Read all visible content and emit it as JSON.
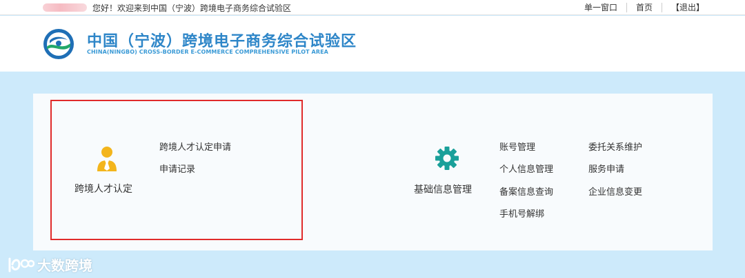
{
  "topbar": {
    "greeting": "您好！欢迎来到中国（宁波）跨境电子商务综合试验区",
    "links": [
      "单一窗口",
      "首页",
      "【退出】"
    ]
  },
  "header": {
    "title_cn": "中国（宁波）跨境电子商务综合试验区",
    "title_en": "CHINA(NINGBO) CROSS-BORDER E-COMMERCE  COMPREHENSIVE PILOT AREA"
  },
  "modules": {
    "talent": {
      "label": "跨境人才认定",
      "icon": "user-tie-icon",
      "links": [
        "跨境人才认定申请",
        "申请记录"
      ]
    },
    "info": {
      "label": "基础信息管理",
      "icon": "gear-icon",
      "links_col1": [
        "账号管理",
        "个人信息管理",
        "备案信息查询",
        "手机号解绑"
      ],
      "links_col2": [
        "委托关系维护",
        "服务申请",
        "企业信息变更"
      ]
    }
  },
  "watermark": {
    "text": "大数跨境"
  },
  "colors": {
    "background": "#cdeafb",
    "accent_blue": "#2e86c8",
    "icon_yellow": "#f3b51c",
    "icon_teal": "#1aa09a",
    "highlight_red": "#e02a2a"
  }
}
